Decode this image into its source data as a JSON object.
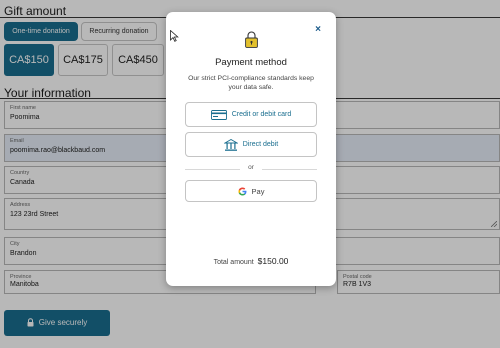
{
  "form": {
    "gift_title": "Gift amount",
    "tabs": [
      "One-time donation",
      "Recurring donation"
    ],
    "amounts": [
      "CA$150",
      "CA$175",
      "CA$450"
    ],
    "info_title": "Your information",
    "fields": {
      "first_name": {
        "label": "First name",
        "value": "Poomima"
      },
      "email": {
        "label": "Email",
        "value": "poomima.rao@blackbaud.com"
      },
      "country": {
        "label": "Country",
        "value": "Canada"
      },
      "address": {
        "label": "Address",
        "value": "123 23rd Street"
      },
      "city": {
        "label": "City",
        "value": "Brandon"
      },
      "province": {
        "label": "Province",
        "value": "Manitoba"
      },
      "postal": {
        "label": "Postal code",
        "value": "R7B 1V3"
      }
    },
    "give_label": "Give securely"
  },
  "modal": {
    "title": "Payment method",
    "description": "Our strict PCI-compliance standards keep your data safe.",
    "close": "×",
    "card_label": "Credit or debit card",
    "debit_label": "Direct debit",
    "or_label": "or",
    "gpay_label": "Pay",
    "total_label": "Total amount",
    "total_value": "$150.00"
  },
  "colors": {
    "accent": "#1a6e8f",
    "lock": "#e2c02d"
  }
}
